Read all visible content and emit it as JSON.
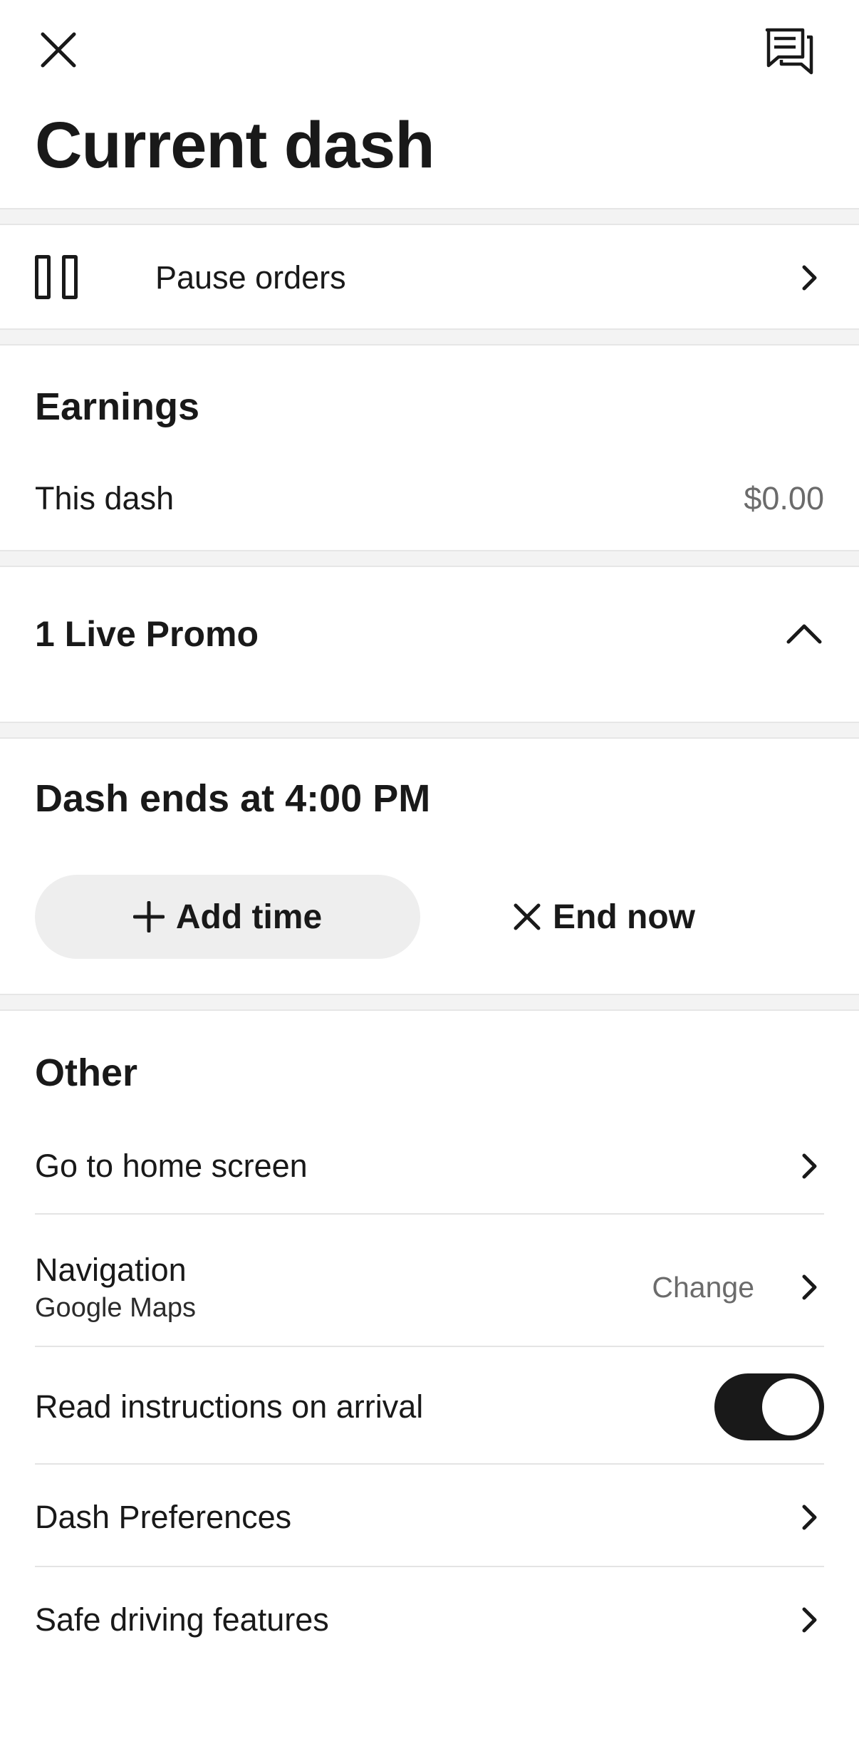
{
  "header": {
    "title": "Current dash",
    "close_icon": "close-icon",
    "chat_icon": "chat-icon"
  },
  "pause": {
    "label": "Pause orders",
    "icon": "pause-icon"
  },
  "earnings": {
    "heading": "Earnings",
    "this_dash_label": "This dash",
    "this_dash_value": "$0.00"
  },
  "promo": {
    "title": "1 Live Promo",
    "expanded": true
  },
  "dash_end": {
    "title": "Dash ends at 4:00 PM",
    "add_time_label": "Add time",
    "end_now_label": "End now"
  },
  "other": {
    "heading": "Other",
    "home_label": "Go to home screen",
    "navigation_label": "Navigation",
    "navigation_value": "Google Maps",
    "navigation_change": "Change",
    "read_instructions_label": "Read instructions on arrival",
    "read_instructions_on": true,
    "prefs_label": "Dash Preferences",
    "safe_driving_label": "Safe driving features"
  },
  "colors": {
    "text": "#191919",
    "muted": "#6b6b6b",
    "divider": "#f3f3f3",
    "button_bg": "#eeeeee"
  }
}
